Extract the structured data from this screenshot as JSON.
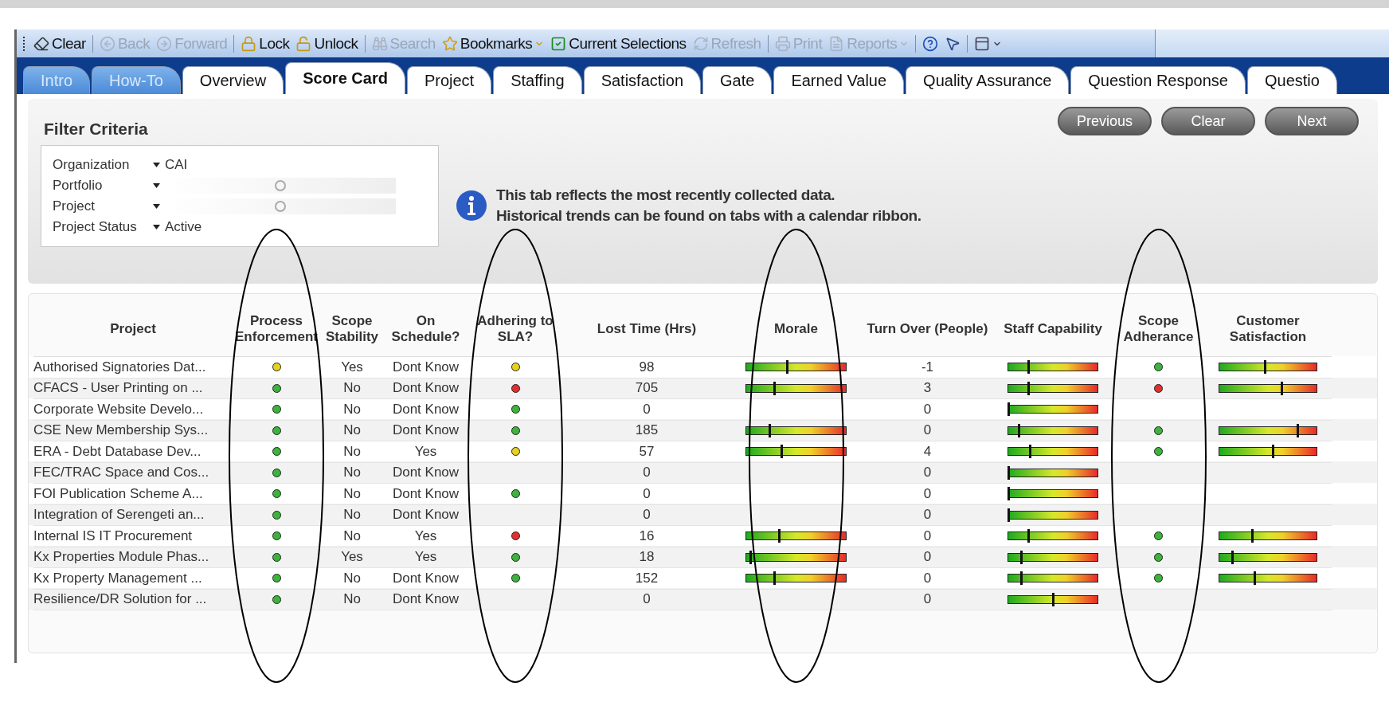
{
  "toolbar": [
    {
      "kind": "button",
      "label": "Clear",
      "disabled": false
    },
    {
      "kind": "separator"
    },
    {
      "kind": "button",
      "label": "Back",
      "disabled": true
    },
    {
      "kind": "button",
      "label": "Forward",
      "disabled": true
    },
    {
      "kind": "separator"
    },
    {
      "kind": "button",
      "label": "Lock",
      "disabled": false
    },
    {
      "kind": "button",
      "label": "Unlock",
      "disabled": false
    },
    {
      "kind": "separator"
    },
    {
      "kind": "button",
      "label": "Search",
      "disabled": true
    },
    {
      "kind": "menu",
      "label": "Bookmarks",
      "disabled": false
    },
    {
      "kind": "button",
      "label": "Current Selections",
      "disabled": false
    },
    {
      "kind": "button",
      "label": "Refresh",
      "disabled": true
    },
    {
      "kind": "separator"
    },
    {
      "kind": "button",
      "label": "Print",
      "disabled": true
    },
    {
      "kind": "menu",
      "label": "Reports",
      "disabled": true
    },
    {
      "kind": "separator"
    },
    {
      "kind": "icon",
      "disabled": false
    },
    {
      "kind": "icon",
      "disabled": false
    },
    {
      "kind": "separator"
    },
    {
      "kind": "icon-menu",
      "disabled": false
    }
  ],
  "tabs": [
    {
      "label": "Intro",
      "kind": "link",
      "selected": false
    },
    {
      "label": "How-To",
      "kind": "link",
      "selected": false
    },
    {
      "label": "Overview",
      "kind": "sheet",
      "selected": false
    },
    {
      "label": "Score Card",
      "kind": "sheet",
      "selected": true
    },
    {
      "label": "Project",
      "kind": "sheet",
      "selected": false
    },
    {
      "label": "Staffing",
      "kind": "sheet",
      "selected": false
    },
    {
      "label": "Satisfaction",
      "kind": "sheet",
      "selected": false
    },
    {
      "label": "Gate",
      "kind": "sheet",
      "selected": false
    },
    {
      "label": "Earned Value",
      "kind": "sheet",
      "selected": false
    },
    {
      "label": "Quality Assurance",
      "kind": "sheet",
      "selected": false
    },
    {
      "label": "Question Response",
      "kind": "sheet",
      "selected": false
    },
    {
      "label": "Questio",
      "kind": "sheet",
      "selected": false
    }
  ],
  "filter": {
    "title": "Filter Criteria",
    "rows": [
      {
        "label": "Organization",
        "kind": "value",
        "value": "CAI"
      },
      {
        "label": "Portfolio",
        "kind": "loading"
      },
      {
        "label": "Project",
        "kind": "loading"
      },
      {
        "label": "Project Status",
        "kind": "value",
        "value": "Active"
      }
    ]
  },
  "info": {
    "lines": [
      "This tab reflects the most recently collected data.",
      "Historical trends can be found on tabs with a calendar ribbon."
    ]
  },
  "nav_buttons": [
    "Previous",
    "Clear",
    "Next"
  ],
  "table": {
    "columns": [
      {
        "label": "Project",
        "kind": "text",
        "circled": false
      },
      {
        "label": "Process Enforcement",
        "kind": "dot",
        "circled": true
      },
      {
        "label": "Scope Stability",
        "kind": "center",
        "circled": false
      },
      {
        "label": "On Schedule?",
        "kind": "center",
        "circled": false
      },
      {
        "label": "Adhering to SLA?",
        "kind": "dot",
        "circled": true
      },
      {
        "label": "Lost Time (Hrs)",
        "kind": "center",
        "circled": false
      },
      {
        "label": "Morale",
        "kind": "gauge",
        "circled": true
      },
      {
        "label": "Turn Over (People)",
        "kind": "center",
        "circled": false
      },
      {
        "label": "Staff Capability",
        "kind": "gauge",
        "circled": false
      },
      {
        "label": "Scope Adherance",
        "kind": "dot",
        "circled": true
      },
      {
        "label": "Customer Satisfaction",
        "kind": "gauge",
        "circled": false
      }
    ],
    "rows": [
      {
        "cells": [
          "Authorised Signatories Dat...",
          {
            "color": "#e6d21c"
          },
          "Yes",
          "Dont Know",
          {
            "color": "#e6d21c"
          },
          "98",
          {
            "level": 0.41
          },
          "-1",
          {
            "level": 0.22
          },
          {
            "color": "#3cb43c"
          },
          {
            "level": 0.47
          }
        ]
      },
      {
        "cells": [
          "CFACS - User Printing on ...",
          {
            "color": "#3cb43c"
          },
          "No",
          "Dont Know",
          {
            "color": "#e03030"
          },
          "705",
          {
            "level": 0.28
          },
          "3",
          {
            "level": 0.22
          },
          {
            "color": "#e03030"
          },
          {
            "level": 0.64
          }
        ]
      },
      {
        "cells": [
          "Corporate Website Develo...",
          {
            "color": "#3cb43c"
          },
          "No",
          "Dont Know",
          {
            "color": "#3cb43c"
          },
          "0",
          null,
          "0",
          {
            "level": 0
          },
          null,
          null
        ]
      },
      {
        "cells": [
          "CSE New Membership Sys...",
          {
            "color": "#3cb43c"
          },
          "No",
          "Dont Know",
          {
            "color": "#3cb43c"
          },
          "185",
          {
            "level": 0.23
          },
          "0",
          {
            "level": 0.12
          },
          {
            "color": "#3cb43c"
          },
          {
            "level": 0.8
          }
        ]
      },
      {
        "cells": [
          "ERA - Debt Database Dev...",
          {
            "color": "#3cb43c"
          },
          "No",
          "Yes",
          {
            "color": "#e6d21c"
          },
          "57",
          {
            "level": 0.35
          },
          "4",
          {
            "level": 0.24
          },
          {
            "color": "#3cb43c"
          },
          {
            "level": 0.55
          }
        ]
      },
      {
        "cells": [
          "FEC/TRAC Space and Cos...",
          {
            "color": "#3cb43c"
          },
          "No",
          "Dont Know",
          null,
          "0",
          null,
          "0",
          {
            "level": 0
          },
          null,
          null
        ]
      },
      {
        "cells": [
          "FOI Publication Scheme A...",
          {
            "color": "#3cb43c"
          },
          "No",
          "Dont Know",
          {
            "color": "#3cb43c"
          },
          "0",
          null,
          "0",
          {
            "level": 0
          },
          null,
          null
        ]
      },
      {
        "cells": [
          "Integration of Serengeti an...",
          {
            "color": "#3cb43c"
          },
          "No",
          "Dont Know",
          null,
          "0",
          null,
          "0",
          {
            "level": 0
          },
          null,
          null
        ]
      },
      {
        "cells": [
          "Internal IS IT Procurement",
          {
            "color": "#3cb43c"
          },
          "No",
          "Yes",
          {
            "color": "#e03030"
          },
          "16",
          {
            "level": 0.33
          },
          "0",
          {
            "level": 0.22
          },
          {
            "color": "#3cb43c"
          },
          {
            "level": 0.34
          }
        ]
      },
      {
        "cells": [
          "Kx Properties Module Phas...",
          {
            "color": "#3cb43c"
          },
          "Yes",
          "Yes",
          {
            "color": "#3cb43c"
          },
          "18",
          {
            "level": 0.04
          },
          "0",
          {
            "level": 0.14
          },
          {
            "color": "#3cb43c"
          },
          {
            "level": 0.13
          }
        ]
      },
      {
        "cells": [
          "Kx Property Management ...",
          {
            "color": "#3cb43c"
          },
          "No",
          "Dont Know",
          {
            "color": "#3cb43c"
          },
          "152",
          {
            "level": 0.28
          },
          "0",
          {
            "level": 0.14
          },
          {
            "color": "#3cb43c"
          },
          {
            "level": 0.36
          }
        ]
      },
      {
        "cells": [
          "Resilience/DR Solution for ...",
          {
            "color": "#3cb43c"
          },
          "No",
          "Dont Know",
          null,
          "0",
          null,
          "0",
          {
            "level": 0.5
          },
          null,
          null
        ]
      }
    ]
  }
}
